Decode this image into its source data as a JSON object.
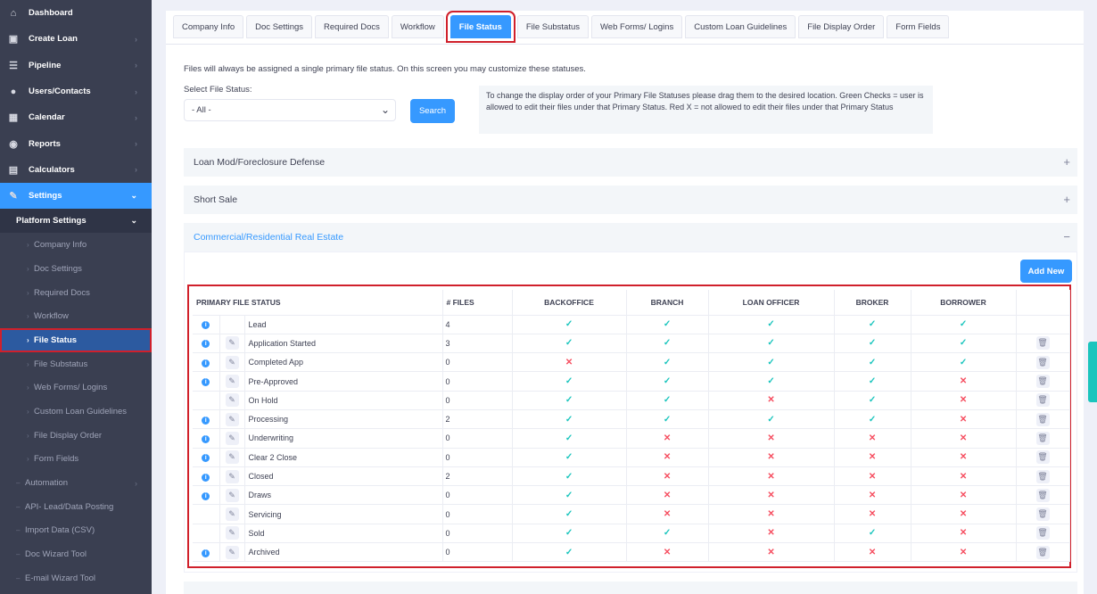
{
  "sidebar": {
    "items": [
      {
        "label": "Dashboard",
        "icon": "home-icon",
        "glyph": "⌂"
      },
      {
        "label": "Create Loan",
        "icon": "loan-icon",
        "glyph": "▣"
      },
      {
        "label": "Pipeline",
        "icon": "pipeline-icon",
        "glyph": "☰"
      },
      {
        "label": "Users/Contacts",
        "icon": "user-icon",
        "glyph": "●"
      },
      {
        "label": "Calendar",
        "icon": "calendar-icon",
        "glyph": "▦"
      },
      {
        "label": "Reports",
        "icon": "reports-icon",
        "glyph": "◉"
      },
      {
        "label": "Calculators",
        "icon": "calculator-icon",
        "glyph": "▤"
      },
      {
        "label": "Settings",
        "icon": "wrench-icon",
        "glyph": "✎"
      }
    ],
    "platform_settings": "Platform Settings",
    "platform_children": [
      "Company Info",
      "Doc Settings",
      "Required Docs",
      "Workflow",
      "File Status",
      "File Substatus",
      "Web Forms/ Logins",
      "Custom Loan Guidelines",
      "File Display Order",
      "Form Fields"
    ],
    "more": [
      "Automation",
      "API- Lead/Data Posting",
      "Import Data (CSV)",
      "Doc Wizard Tool",
      "E-mail Wizard Tool"
    ]
  },
  "tabs": [
    "Company Info",
    "Doc Settings",
    "Required Docs",
    "Workflow",
    "File Status",
    "File Substatus",
    "Web Forms/ Logins",
    "Custom Loan Guidelines",
    "File Display Order",
    "Form Fields"
  ],
  "page": {
    "note": "Files will always be assigned a single primary file status. On this screen you may customize these statuses.",
    "select_label": "Select File Status:",
    "select_value": "- All -",
    "search_label": "Search",
    "help": "To change the display order of your Primary File Statuses please drag them to the desired location. Green Checks = user is allowed to edit their files under that Primary Status. Red X = not allowed to edit their files under that Primary Status"
  },
  "accordions": [
    "Loan Mod/Foreclosure Defense",
    "Short Sale",
    "Commercial/Residential Real Estate"
  ],
  "add_new_label": "Add New",
  "table": {
    "headers": [
      "PRIMARY FILE STATUS",
      "# FILES",
      "BACKOFFICE",
      "BRANCH",
      "LOAN OFFICER",
      "BROKER",
      "BORROWER"
    ],
    "rows": [
      {
        "name": "Lead",
        "files": "4",
        "info": true,
        "edit": false,
        "del": false,
        "perm": [
          1,
          1,
          1,
          1,
          1
        ]
      },
      {
        "name": "Application Started",
        "files": "3",
        "info": true,
        "edit": true,
        "del": true,
        "perm": [
          1,
          1,
          1,
          1,
          1
        ]
      },
      {
        "name": "Completed App",
        "files": "0",
        "info": true,
        "edit": true,
        "del": true,
        "perm": [
          0,
          1,
          1,
          1,
          1
        ]
      },
      {
        "name": "Pre-Approved",
        "files": "0",
        "info": true,
        "edit": true,
        "del": true,
        "perm": [
          1,
          1,
          1,
          1,
          0
        ]
      },
      {
        "name": "On Hold",
        "files": "0",
        "info": false,
        "edit": true,
        "del": true,
        "perm": [
          1,
          1,
          0,
          1,
          0
        ]
      },
      {
        "name": "Processing",
        "files": "2",
        "info": true,
        "edit": true,
        "del": true,
        "perm": [
          1,
          1,
          1,
          1,
          0
        ]
      },
      {
        "name": "Underwriting",
        "files": "0",
        "info": true,
        "edit": true,
        "del": true,
        "perm": [
          1,
          0,
          0,
          0,
          0
        ]
      },
      {
        "name": "Clear 2 Close",
        "files": "0",
        "info": true,
        "edit": true,
        "del": true,
        "perm": [
          1,
          0,
          0,
          0,
          0
        ]
      },
      {
        "name": "Closed",
        "files": "2",
        "info": true,
        "edit": true,
        "del": true,
        "perm": [
          1,
          0,
          0,
          0,
          0
        ]
      },
      {
        "name": "Draws",
        "files": "0",
        "info": true,
        "edit": true,
        "del": true,
        "perm": [
          1,
          0,
          0,
          0,
          0
        ]
      },
      {
        "name": "Servicing",
        "files": "0",
        "info": false,
        "edit": true,
        "del": true,
        "perm": [
          1,
          0,
          0,
          0,
          0
        ]
      },
      {
        "name": "Sold",
        "files": "0",
        "info": false,
        "edit": true,
        "del": true,
        "perm": [
          1,
          1,
          0,
          1,
          0
        ]
      },
      {
        "name": "Archived",
        "files": "0",
        "info": true,
        "edit": true,
        "del": true,
        "perm": [
          1,
          0,
          0,
          0,
          0
        ]
      }
    ]
  },
  "colors": {
    "accent": "#3699ff",
    "sidebar": "#3a3f51",
    "check": "#1bc5bd",
    "cross": "#f64e60",
    "highlight": "#d0202b"
  }
}
